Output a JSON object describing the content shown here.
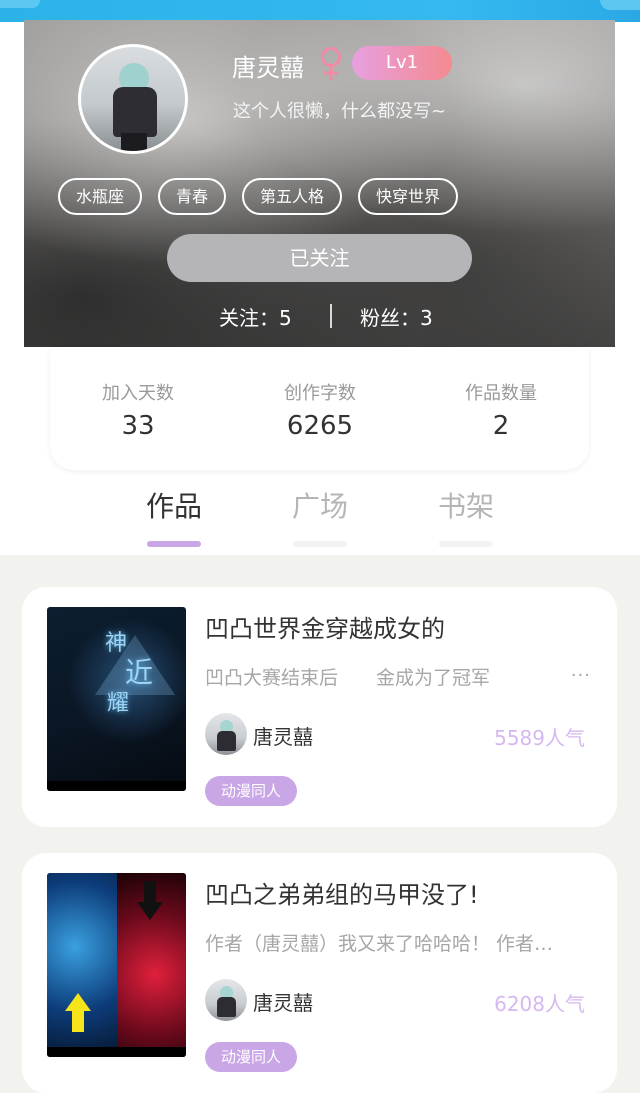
{
  "profile": {
    "name": "唐灵囍",
    "gender_symbol": "♀",
    "level": "Lv1",
    "signature": "这个人很懒，什么都没写~",
    "tags": [
      "水瓶座",
      "青春",
      "第五人格",
      "快穿世界"
    ],
    "follow_button": "已关注",
    "following": "关注：5",
    "fans": "粉丝：3",
    "gender_color": "#f08aa5"
  },
  "stats": [
    {
      "label": "加入天数",
      "value": "33"
    },
    {
      "label": "创作字数",
      "value": "6265"
    },
    {
      "label": "作品数量",
      "value": "2"
    }
  ],
  "tabs": [
    {
      "label": "作品",
      "active": true
    },
    {
      "label": "广场",
      "active": false
    },
    {
      "label": "书架",
      "active": false
    }
  ],
  "works": [
    {
      "title": "凹凸世界金穿越成女的",
      "desc": "凹凸大赛结束后　　金成为了冠军",
      "author": "唐灵囍",
      "popularity": "5589人气",
      "tag": "动漫同人",
      "cover_text": [
        "神",
        "近",
        "耀"
      ]
    },
    {
      "title": "凹凸之弟弟组的马甲没了!",
      "desc": "作者（唐灵囍）我又来了哈哈哈！ 作者…",
      "author": "唐灵囍",
      "popularity": "6208人气",
      "tag": "动漫同人"
    }
  ],
  "more_symbol": "···",
  "colors": {
    "accent_purple": "#c9a6e6",
    "popularity": "#d6b8ef",
    "top_bar": "#2bb3e8"
  }
}
